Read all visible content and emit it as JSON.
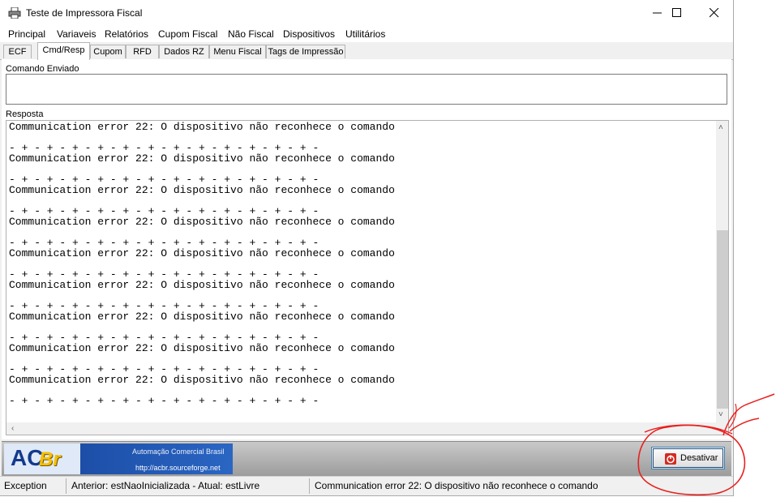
{
  "window": {
    "title": "Teste de Impressora Fiscal"
  },
  "menu": [
    "Principal",
    "Variaveis",
    "Relatórios",
    "Cupom Fiscal",
    "Não Fiscal",
    "Dispositivos",
    "Utilitários"
  ],
  "tabs": [
    {
      "label": "ECF",
      "active": false
    },
    {
      "label": "Cmd/Resp",
      "active": true
    },
    {
      "label": "Cupom",
      "active": false
    },
    {
      "label": "RFD",
      "active": false
    },
    {
      "label": "Dados RZ",
      "active": false
    },
    {
      "label": "Menu Fiscal",
      "active": false
    },
    {
      "label": "Tags de Impressão",
      "active": false
    }
  ],
  "command": {
    "label": "Comando Enviado",
    "value": ""
  },
  "response": {
    "label": "Resposta",
    "lines": [
      "Communication error 22: O dispositivo não reconhece o comando",
      "",
      "- + - + - + - + - + - + - + - + - + - + - + - + -",
      "Communication error 22: O dispositivo não reconhece o comando",
      "",
      "- + - + - + - + - + - + - + - + - + - + - + - + -",
      "Communication error 22: O dispositivo não reconhece o comando",
      "",
      "- + - + - + - + - + - + - + - + - + - + - + - + -",
      "Communication error 22: O dispositivo não reconhece o comando",
      "",
      "- + - + - + - + - + - + - + - + - + - + - + - + -",
      "Communication error 22: O dispositivo não reconhece o comando",
      "",
      "- + - + - + - + - + - + - + - + - + - + - + - + -",
      "Communication error 22: O dispositivo não reconhece o comando",
      "",
      "- + - + - + - + - + - + - + - + - + - + - + - + -",
      "Communication error 22: O dispositivo não reconhece o comando",
      "",
      "- + - + - + - + - + - + - + - + - + - + - + - + -",
      "Communication error 22: O dispositivo não reconhece o comando",
      "",
      "- + - + - + - + - + - + - + - + - + - + - + - + -",
      "Communication error 22: O dispositivo não reconhece o comando",
      "",
      "- + - + - + - + - + - + - + - + - + - + - + - + -"
    ]
  },
  "banner": {
    "logo_a": "AC",
    "logo_br": "Br",
    "title": "Automação Comercial Brasil",
    "url": "http://acbr.sourceforge.net"
  },
  "buttons": {
    "desativar": "Desativar"
  },
  "status": {
    "panel1": "Exception",
    "panel2": "Anterior: estNaoInicializada - Atual: estLivre",
    "panel3": "Communication error 22: O dispositivo não reconhece o comando"
  },
  "colors": {
    "annotation": "#e8201e",
    "button_border": "#3c7fb1",
    "power_icon": "#d42a20"
  },
  "icons": {
    "app": "printer-icon",
    "button": "power-icon"
  }
}
